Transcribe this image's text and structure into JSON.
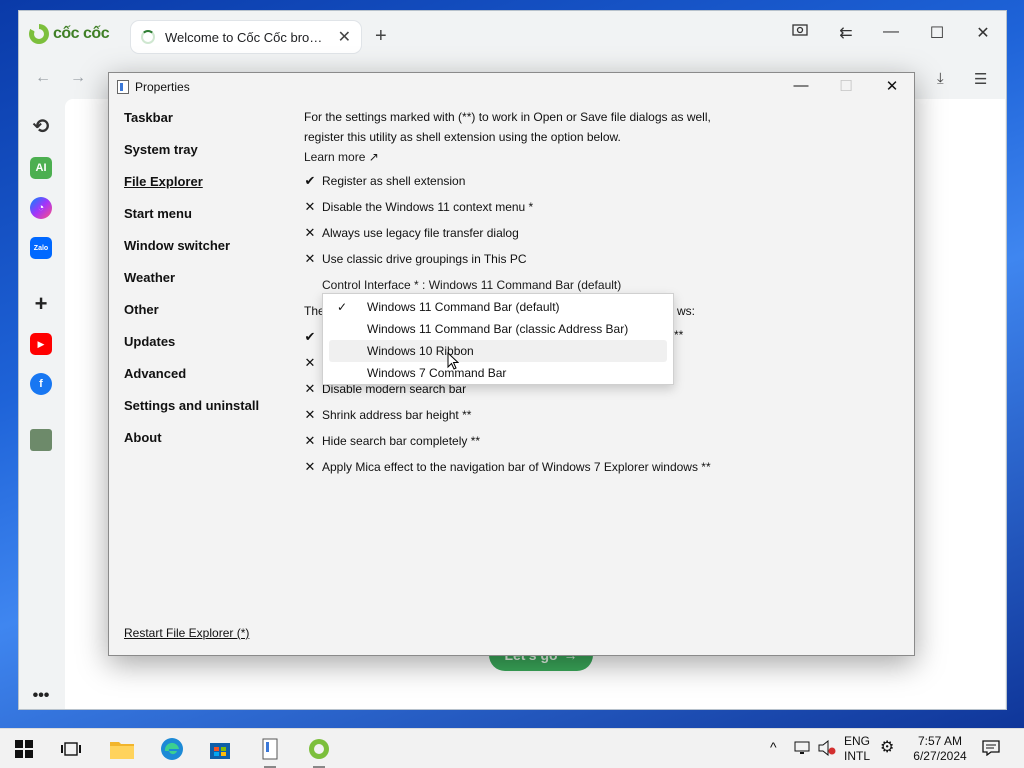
{
  "browser": {
    "brand": "cốc cốc",
    "tab_title": "Welcome to Cốc Cốc browser",
    "content_button": "Let's go"
  },
  "dialog": {
    "title": "Properties",
    "nav": [
      {
        "label": "Taskbar",
        "active": false
      },
      {
        "label": "System tray",
        "active": false
      },
      {
        "label": "File Explorer",
        "active": true
      },
      {
        "label": "Start menu",
        "active": false
      },
      {
        "label": "Window switcher",
        "active": false
      },
      {
        "label": "Weather",
        "active": false
      },
      {
        "label": "Other",
        "active": false
      },
      {
        "label": "Updates",
        "active": false
      },
      {
        "label": "Advanced",
        "active": false
      },
      {
        "label": "Settings and uninstall",
        "active": false
      },
      {
        "label": "About",
        "active": false
      }
    ],
    "intro": "For the settings marked with (**) to work in Open or Save file dialogs as well, register this utility as shell extension using the option below.",
    "learn_more": "Learn more ↗",
    "options_top": [
      {
        "checked": true,
        "label": "Register as shell extension"
      },
      {
        "checked": false,
        "label": "Disable the Windows 11 context menu *"
      },
      {
        "checked": false,
        "label": "Always use legacy file transfer dialog"
      },
      {
        "checked": false,
        "label": "Use classic drive groupings in This PC"
      }
    ],
    "control_interface_label": "Control Interface * : Windows 11 Command Bar (default)",
    "partial_line_start": "The",
    "partial_line_end": "ws:",
    "partial_row_end": "**",
    "options_bottom": [
      {
        "checked": false,
        "label": "Disable modern search bar"
      },
      {
        "checked": false,
        "label": "Shrink address bar height **"
      },
      {
        "checked": false,
        "label": "Hide search bar completely **"
      },
      {
        "checked": false,
        "label": "Apply Mica effect to the navigation bar of Windows 7 Explorer windows **"
      }
    ],
    "dropdown": [
      {
        "label": "Windows 11 Command Bar (default)",
        "selected": true,
        "hover": false
      },
      {
        "label": "Windows 11 Command Bar (classic Address Bar)",
        "selected": false,
        "hover": false
      },
      {
        "label": "Windows 10 Ribbon",
        "selected": false,
        "hover": true
      },
      {
        "label": "Windows 7 Command Bar",
        "selected": false,
        "hover": false
      }
    ],
    "restart": "Restart File Explorer (*)"
  },
  "taskbar": {
    "lang_top": "ENG",
    "lang_bottom": "INTL",
    "time": "7:57 AM",
    "date": "6/27/2024"
  },
  "colors": {
    "coccoc_green": "#3f7f25",
    "accent_blue": "#0067c0"
  }
}
